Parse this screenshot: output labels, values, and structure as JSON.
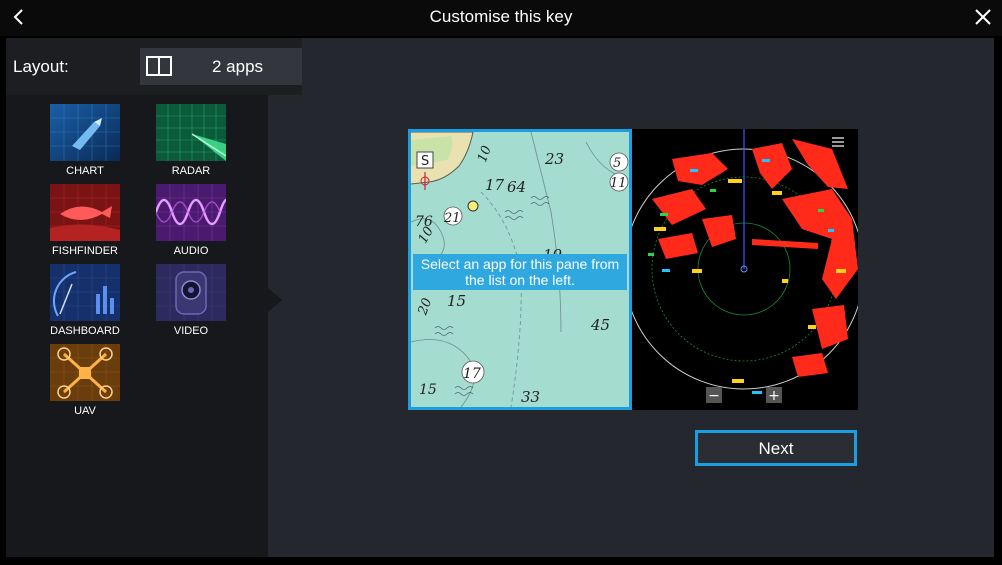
{
  "header": {
    "title": "Customise this key",
    "back_icon": "chevron-left-icon",
    "close_icon": "close-icon"
  },
  "layout": {
    "label": "Layout:",
    "value": "2 apps",
    "icon": "split-pane-icon"
  },
  "apps": [
    {
      "label": "CHART",
      "icon": "chart-app-icon"
    },
    {
      "label": "RADAR",
      "icon": "radar-app-icon"
    },
    {
      "label": "FISHFINDER",
      "icon": "fishfinder-app-icon"
    },
    {
      "label": "AUDIO",
      "icon": "audio-app-icon"
    },
    {
      "label": "DASHBOARD",
      "icon": "dashboard-app-icon"
    },
    {
      "label": "VIDEO",
      "icon": "video-app-icon"
    },
    {
      "label": "UAV",
      "icon": "uav-app-icon"
    }
  ],
  "preview": {
    "pane_hint": "Select an app for this pane from the list on the left.",
    "chart_depths": [
      "23",
      "10",
      "17",
      "64",
      "5",
      "11",
      "76",
      "21",
      "10",
      "19",
      "20",
      "15",
      "45",
      "17",
      "15",
      "33"
    ],
    "radar_zoom_out": "−",
    "radar_zoom_in": "+"
  },
  "actions": {
    "next_label": "Next"
  },
  "colors": {
    "accent": "#1b9ee0",
    "background": "#24272d",
    "panel": "#17181b"
  }
}
